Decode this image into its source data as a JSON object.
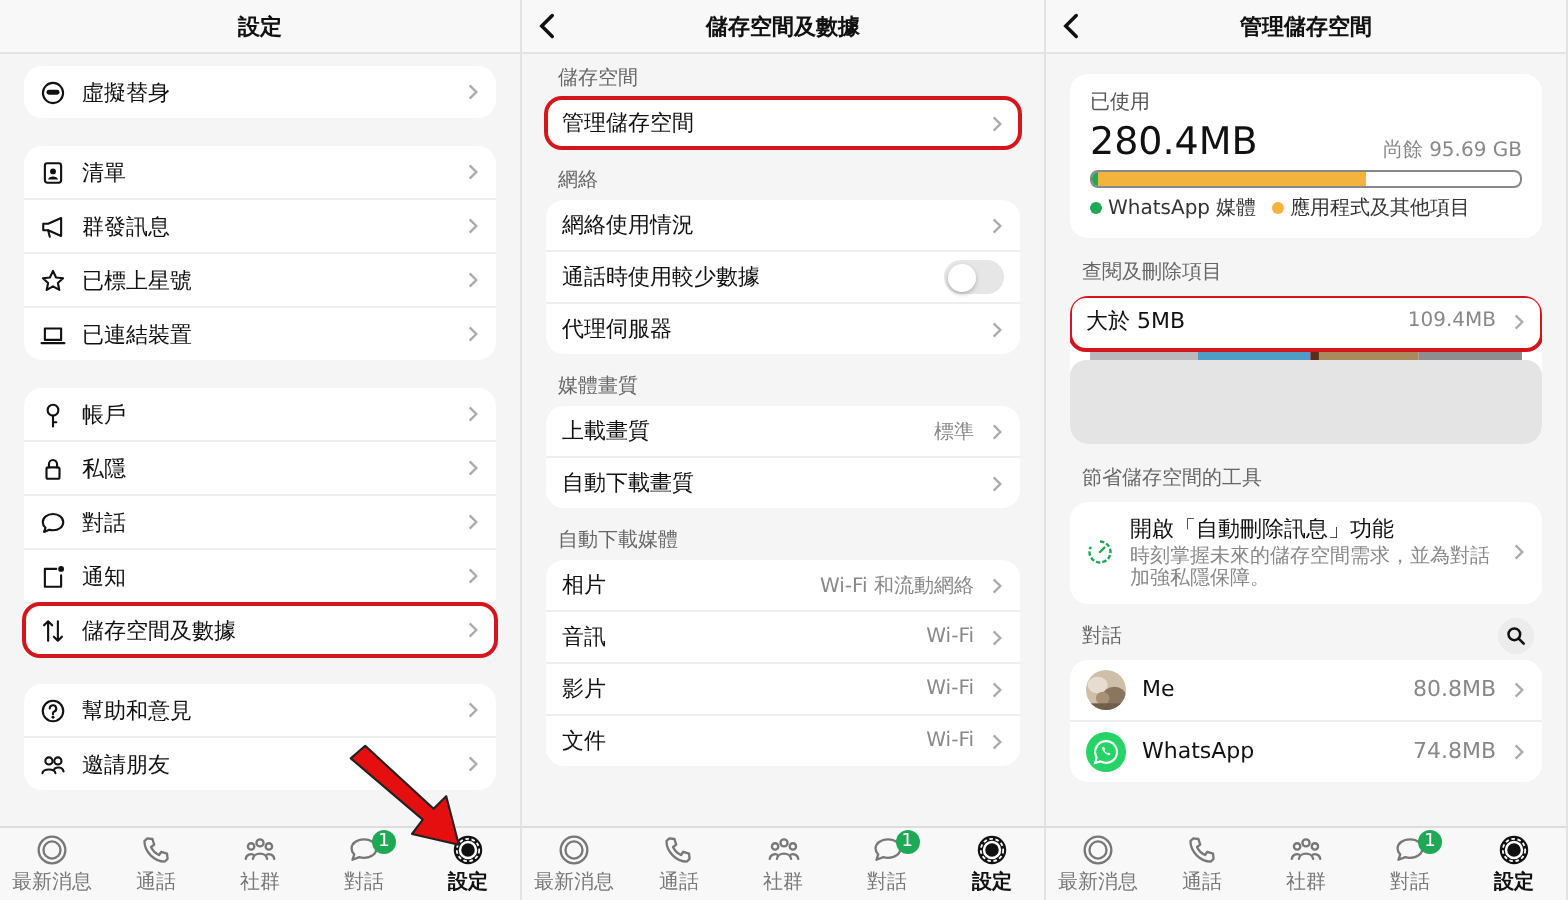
{
  "panels": [
    {
      "kind": "settings",
      "title": "設定",
      "back": false,
      "pointer_arrow": true,
      "sections": [
        {
          "items": [
            {
              "label": "虛擬替身",
              "highlighted": false
            }
          ]
        },
        {
          "items": [
            {
              "label": "清單",
              "highlighted": false
            },
            {
              "label": "群發訊息",
              "highlighted": false
            },
            {
              "label": "已標上星號",
              "highlighted": false
            },
            {
              "label": "已連結裝置",
              "highlighted": false
            }
          ]
        },
        {
          "items": [
            {
              "label": "帳戶",
              "highlighted": false
            },
            {
              "label": "私隱",
              "highlighted": false
            },
            {
              "label": "對話",
              "highlighted": false
            },
            {
              "label": "通知",
              "highlighted": false
            },
            {
              "label": "儲存空間及數據",
              "highlighted": true
            }
          ]
        },
        {
          "items": [
            {
              "label": "幫助和意見",
              "highlighted": false
            },
            {
              "label": "邀請朋友",
              "highlighted": false
            }
          ]
        }
      ],
      "tabs": [
        {
          "label": "最新消息",
          "selected": false
        },
        {
          "label": "通話",
          "selected": false
        },
        {
          "label": "社群",
          "selected": false
        },
        {
          "label": "對話",
          "selected": false,
          "badge": "1"
        },
        {
          "label": "設定",
          "selected": true
        }
      ]
    },
    {
      "kind": "storage_data",
      "title": "儲存空間及數據",
      "back": true,
      "pointer_arrow": false,
      "sections": [
        {
          "heading": "儲存空間",
          "items": [
            {
              "label": "管理儲存空間",
              "kind": "link",
              "highlighted": true
            }
          ]
        },
        {
          "heading": "網絡",
          "items": [
            {
              "label": "網絡使用情況",
              "kind": "link",
              "highlighted": false
            },
            {
              "label": "通話時使用較少數據",
              "kind": "toggle",
              "on": false,
              "highlighted": false
            },
            {
              "label": "代理伺服器",
              "kind": "link",
              "highlighted": false
            }
          ]
        },
        {
          "heading": "媒體畫質",
          "items": [
            {
              "label": "上載畫質",
              "value": "標準",
              "kind": "link",
              "highlighted": false
            },
            {
              "label": "自動下載畫質",
              "kind": "link",
              "highlighted": false
            }
          ]
        },
        {
          "heading": "自動下載媒體",
          "items": [
            {
              "label": "相片",
              "value": "Wi-Fi 和流動網絡",
              "kind": "link",
              "highlighted": false
            },
            {
              "label": "音訊",
              "value": "Wi-Fi",
              "kind": "link",
              "highlighted": false
            },
            {
              "label": "影片",
              "value": "Wi-Fi",
              "kind": "link",
              "highlighted": false
            },
            {
              "label": "文件",
              "value": "Wi-Fi",
              "kind": "link",
              "highlighted": false
            }
          ]
        }
      ],
      "tabs": [
        {
          "label": "最新消息",
          "selected": false
        },
        {
          "label": "通話",
          "selected": false
        },
        {
          "label": "社群",
          "selected": false
        },
        {
          "label": "對話",
          "selected": false,
          "badge": "1"
        },
        {
          "label": "設定",
          "selected": true
        }
      ]
    },
    {
      "kind": "manage_storage",
      "title": "管理儲存空間",
      "back": true,
      "pointer_arrow": false,
      "usage": {
        "label": "已使用",
        "used": "280.4MB",
        "free": "尚餘 95.69 GB",
        "segments": [
          {
            "label": "WhatsApp 媒體",
            "color": "#1fa855",
            "level": 0.012
          },
          {
            "label": "應用程式及其他項目",
            "color": "#f4b23e",
            "level": 0.63
          }
        ]
      },
      "review": {
        "heading": "查閱及刪除項目",
        "item": {
          "label": "大於 5MB",
          "value": "109.4MB",
          "highlighted": true
        }
      },
      "tools": {
        "heading": "節省儲存空間的工具",
        "items": [
          {
            "title": "開啟「自動刪除訊息」功能",
            "subtitle": "時刻掌握未來的儲存空間需求，並為對話加強私隱保障。"
          }
        ]
      },
      "chats": {
        "heading": "對話",
        "items": [
          {
            "name": "Me",
            "size": "80.8MB"
          },
          {
            "name": "WhatsApp",
            "size": "74.8MB",
            "kind": "logo"
          }
        ]
      },
      "tabs": [
        {
          "label": "最新消息",
          "selected": false
        },
        {
          "label": "通話",
          "selected": false
        },
        {
          "label": "社群",
          "selected": false
        },
        {
          "label": "對話",
          "selected": false,
          "badge": "1"
        },
        {
          "label": "設定",
          "selected": true
        }
      ]
    }
  ]
}
